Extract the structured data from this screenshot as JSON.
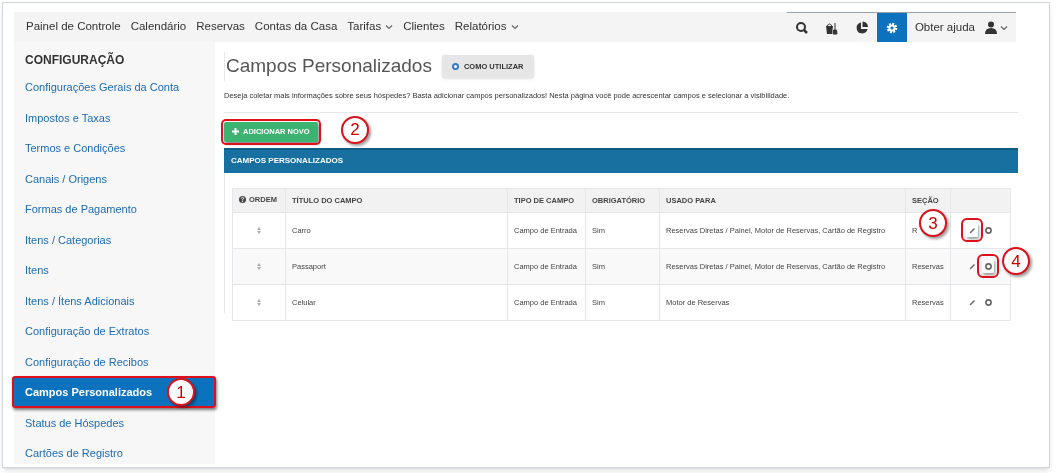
{
  "nav": {
    "items": [
      {
        "label": "Painel de Controle",
        "dropdown": false
      },
      {
        "label": "Calendário",
        "dropdown": false
      },
      {
        "label": "Reservas",
        "dropdown": false
      },
      {
        "label": "Contas da Casa",
        "dropdown": false
      },
      {
        "label": "Tarifas",
        "dropdown": true
      },
      {
        "label": "Clientes",
        "dropdown": false
      },
      {
        "label": "Relatórios",
        "dropdown": true
      }
    ],
    "tools": [
      {
        "kind": "search",
        "selected": false
      },
      {
        "kind": "housekeeping",
        "selected": false
      },
      {
        "kind": "chart",
        "selected": false
      },
      {
        "kind": "settings",
        "selected": true
      }
    ],
    "help": "Obter ajuda"
  },
  "sidebar": {
    "title": "CONFIGURAÇÃO",
    "items": [
      {
        "label": "Configurações Gerais da Conta",
        "selected": false
      },
      {
        "label": "Impostos e Taxas",
        "selected": false
      },
      {
        "label": "Termos e Condições",
        "selected": false
      },
      {
        "label": "Canais / Origens",
        "selected": false
      },
      {
        "label": "Formas de Pagamento",
        "selected": false
      },
      {
        "label": "Itens / Categorias",
        "selected": false
      },
      {
        "label": "Itens",
        "selected": false
      },
      {
        "label": "Itens / Ítens Adicionais",
        "selected": false
      },
      {
        "label": "Configuração de Extratos",
        "selected": false
      },
      {
        "label": "Configuração de Recibos",
        "selected": false
      },
      {
        "label": "Campos Personalizados",
        "selected": true,
        "callout": "1"
      },
      {
        "label": "Status de Hóspedes",
        "selected": false
      },
      {
        "label": "Cartões de Registro",
        "selected": false
      }
    ]
  },
  "page": {
    "title": "Campos Personalizados",
    "help_button": "COMO UTILIZAR",
    "description": "Deseja coletar mais informações sobre seus hóspedes? Basta adicionar campos personalizados! Nesta página você pode acrescentar campos e selecionar a visibilidade.",
    "add_button": {
      "label": "ADICIONAR NOVO",
      "callout": "2"
    }
  },
  "panel": {
    "title": "CAMPOS PERSONALIZADOS"
  },
  "table": {
    "columns": [
      "ORDEM",
      "TÍTULO DO CAMPO",
      "TIPO DE CAMPO",
      "OBRIGATÓRIO",
      "USADO PARA",
      "SEÇÃO"
    ],
    "rows": [
      {
        "title": "Carro",
        "type": "Campo de Entrada",
        "required": "Sim",
        "used_for": "Reservas Diretas / Painel, Motor de Reservas, Cartão de Registro",
        "section": "R",
        "edit_callout": "3"
      },
      {
        "title": "Passaport",
        "type": "Campo de Entrada",
        "required": "Sim",
        "used_for": "Reservas Diretas / Painel, Motor de Reservas, Cartão de Registro",
        "section": "Reservas",
        "delete_callout": "4"
      },
      {
        "title": "Celular",
        "type": "Campo de Entrada",
        "required": "Sim",
        "used_for": "Motor de Reservas",
        "section": "Reservas"
      }
    ]
  }
}
